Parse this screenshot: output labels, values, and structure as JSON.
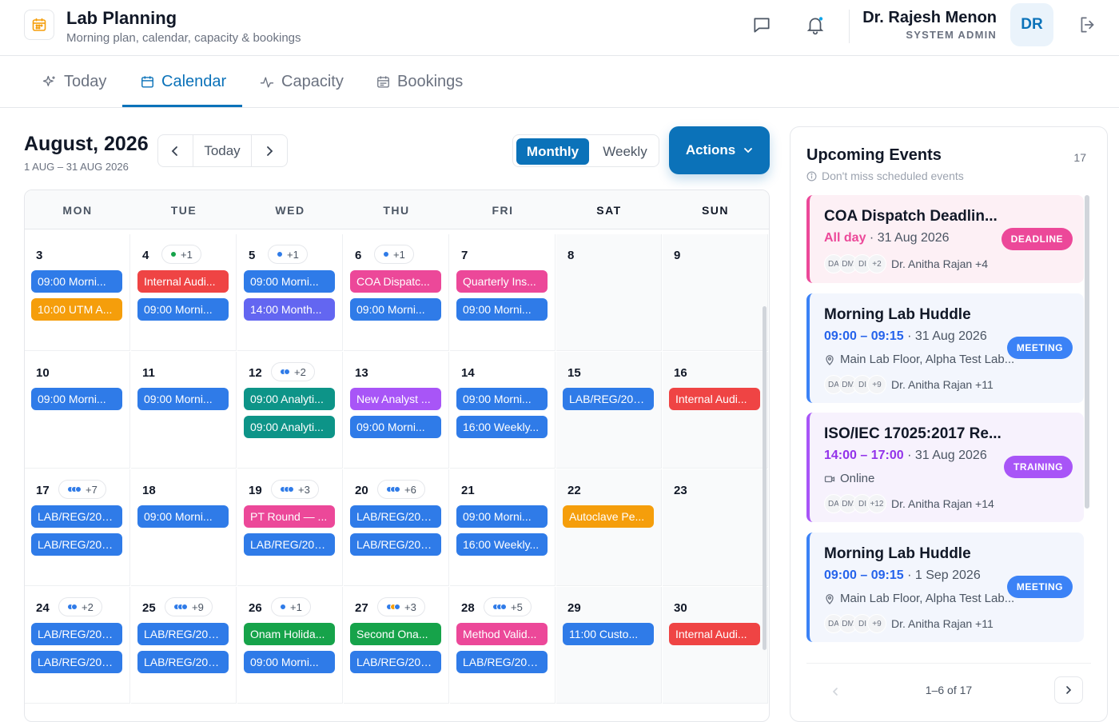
{
  "app": {
    "title": "Lab Planning",
    "subtitle": "Morning plan, calendar, capacity & bookings"
  },
  "user": {
    "name": "Dr. Rajesh Menon",
    "role": "SYSTEM ADMIN",
    "initials": "DR"
  },
  "tabs": [
    {
      "label": "Today",
      "icon": "sparkle-icon",
      "active": false
    },
    {
      "label": "Calendar",
      "icon": "calendar-icon",
      "active": true
    },
    {
      "label": "Capacity",
      "icon": "activity-icon",
      "active": false
    },
    {
      "label": "Bookings",
      "icon": "calendar-list-icon",
      "active": false
    }
  ],
  "calendar": {
    "title": "August, 2026",
    "range": "1 AUG – 31 AUG 2026",
    "today_label": "Today",
    "view_monthly": "Monthly",
    "view_weekly": "Weekly",
    "active_view": "Monthly",
    "actions_label": "Actions",
    "weekdays": [
      "MON",
      "TUE",
      "WED",
      "THU",
      "FRI",
      "SAT",
      "SUN"
    ]
  },
  "colors": {
    "blue": "#2f7be8",
    "orange": "#f59e0b",
    "red": "#ef4444",
    "indigo": "#6366f1",
    "pink": "#ec4899",
    "teal": "#0d9488",
    "purple": "#a855f7",
    "green": "#16a34a",
    "accent": "#0b72b9"
  },
  "weeks": [
    [
      {
        "day": "3",
        "more": "",
        "dots": [],
        "events": [
          {
            "text": "09:00 Morni...",
            "color": "blue"
          },
          {
            "text": "10:00 UTM A...",
            "color": "orange"
          }
        ]
      },
      {
        "day": "4",
        "more": "+1",
        "dots": [
          "#16a34a"
        ],
        "events": [
          {
            "text": "Internal Audi...",
            "color": "red"
          },
          {
            "text": "09:00 Morni...",
            "color": "blue"
          }
        ]
      },
      {
        "day": "5",
        "more": "+1",
        "dots": [
          "#2f7be8"
        ],
        "events": [
          {
            "text": "09:00 Morni...",
            "color": "blue"
          },
          {
            "text": "14:00 Month...",
            "color": "indigo"
          }
        ]
      },
      {
        "day": "6",
        "more": "+1",
        "dots": [
          "#2f7be8"
        ],
        "events": [
          {
            "text": "COA Dispatc...",
            "color": "pink"
          },
          {
            "text": "09:00 Morni...",
            "color": "blue"
          }
        ]
      },
      {
        "day": "7",
        "more": "",
        "dots": [],
        "events": [
          {
            "text": "Quarterly Ins...",
            "color": "pink"
          },
          {
            "text": "09:00 Morni...",
            "color": "blue"
          }
        ]
      },
      {
        "day": "8",
        "more": "",
        "dots": [],
        "events": []
      },
      {
        "day": "9",
        "more": "",
        "dots": [],
        "events": []
      }
    ],
    [
      {
        "day": "10",
        "more": "",
        "dots": [],
        "events": [
          {
            "text": "09:00 Morni...",
            "color": "blue"
          }
        ]
      },
      {
        "day": "11",
        "more": "",
        "dots": [],
        "events": [
          {
            "text": "09:00 Morni...",
            "color": "blue"
          }
        ]
      },
      {
        "day": "12",
        "more": "+2",
        "dots": [
          "#2f7be8",
          "#2f7be8"
        ],
        "events": [
          {
            "text": "09:00 Analyti...",
            "color": "teal"
          },
          {
            "text": "09:00 Analyti...",
            "color": "teal"
          }
        ]
      },
      {
        "day": "13",
        "more": "",
        "dots": [],
        "events": [
          {
            "text": "New Analyst ...",
            "color": "purple"
          },
          {
            "text": "09:00 Morni...",
            "color": "blue"
          }
        ]
      },
      {
        "day": "14",
        "more": "",
        "dots": [],
        "events": [
          {
            "text": "09:00 Morni...",
            "color": "blue"
          },
          {
            "text": "16:00 Weekly...",
            "color": "blue"
          }
        ]
      },
      {
        "day": "15",
        "more": "",
        "dots": [],
        "events": [
          {
            "text": "LAB/REG/202...",
            "color": "blue"
          }
        ]
      },
      {
        "day": "16",
        "more": "",
        "dots": [],
        "events": [
          {
            "text": "Internal Audi...",
            "color": "red"
          }
        ]
      }
    ],
    [
      {
        "day": "17",
        "more": "+7",
        "dots": [
          "#2f7be8",
          "#2f7be8",
          "#2f7be8"
        ],
        "events": [
          {
            "text": "LAB/REG/202...",
            "color": "blue"
          },
          {
            "text": "LAB/REG/202...",
            "color": "blue"
          }
        ]
      },
      {
        "day": "18",
        "more": "",
        "dots": [],
        "events": [
          {
            "text": "09:00 Morni...",
            "color": "blue"
          }
        ]
      },
      {
        "day": "19",
        "more": "+3",
        "dots": [
          "#2f7be8",
          "#2f7be8",
          "#2f7be8"
        ],
        "events": [
          {
            "text": "PT Round — ...",
            "color": "pink"
          },
          {
            "text": "LAB/REG/202...",
            "color": "blue"
          }
        ]
      },
      {
        "day": "20",
        "more": "+6",
        "dots": [
          "#2f7be8",
          "#2f7be8",
          "#2f7be8"
        ],
        "events": [
          {
            "text": "LAB/REG/202...",
            "color": "blue"
          },
          {
            "text": "LAB/REG/202...",
            "color": "blue"
          }
        ]
      },
      {
        "day": "21",
        "more": "",
        "dots": [],
        "events": [
          {
            "text": "09:00 Morni...",
            "color": "blue"
          },
          {
            "text": "16:00 Weekly...",
            "color": "blue"
          }
        ]
      },
      {
        "day": "22",
        "more": "",
        "dots": [],
        "events": [
          {
            "text": "Autoclave Pe...",
            "color": "orange"
          }
        ]
      },
      {
        "day": "23",
        "more": "",
        "dots": [],
        "events": []
      }
    ],
    [
      {
        "day": "24",
        "more": "+2",
        "dots": [
          "#2f7be8",
          "#2f7be8"
        ],
        "events": [
          {
            "text": "LAB/REG/202...",
            "color": "blue"
          },
          {
            "text": "LAB/REG/202...",
            "color": "blue"
          }
        ]
      },
      {
        "day": "25",
        "more": "+9",
        "dots": [
          "#2f7be8",
          "#2f7be8",
          "#2f7be8"
        ],
        "events": [
          {
            "text": "LAB/REG/202...",
            "color": "blue"
          },
          {
            "text": "LAB/REG/202...",
            "color": "blue"
          }
        ]
      },
      {
        "day": "26",
        "more": "+1",
        "dots": [
          "#2f7be8"
        ],
        "events": [
          {
            "text": "Onam Holida...",
            "color": "green"
          },
          {
            "text": "09:00 Morni...",
            "color": "blue"
          }
        ]
      },
      {
        "day": "27",
        "more": "+3",
        "dots": [
          "#2f7be8",
          "#f59e0b",
          "#2f7be8"
        ],
        "events": [
          {
            "text": "Second Ona...",
            "color": "green"
          },
          {
            "text": "LAB/REG/202...",
            "color": "blue"
          }
        ]
      },
      {
        "day": "28",
        "more": "+5",
        "dots": [
          "#2f7be8",
          "#2f7be8",
          "#2f7be8"
        ],
        "events": [
          {
            "text": "Method Valid...",
            "color": "pink"
          },
          {
            "text": "LAB/REG/202...",
            "color": "blue"
          }
        ]
      },
      {
        "day": "29",
        "more": "",
        "dots": [],
        "events": [
          {
            "text": "11:00 Custo...",
            "color": "blue"
          }
        ]
      },
      {
        "day": "30",
        "more": "",
        "dots": [],
        "events": [
          {
            "text": "Internal Audi...",
            "color": "red"
          }
        ]
      }
    ]
  ],
  "upcoming": {
    "title": "Upcoming Events",
    "count": "17",
    "subtitle": "Don't miss scheduled events",
    "cards": [
      {
        "title": "COA Dispatch Deadlin...",
        "time": "All day",
        "date": " · 31 Aug 2026",
        "location": "",
        "people": [
          "DA",
          "DM",
          "DI"
        ],
        "people_more": "+2",
        "people_text": "Dr. Anitha Rajan +4",
        "badge": "DEADLINE",
        "badge_color": "#ec4899",
        "bg": "#fdf0f5",
        "border": "#ec4899",
        "time_color": "#ec4899",
        "loc_icon": ""
      },
      {
        "title": "Morning Lab Huddle",
        "time": "09:00 – 09:15",
        "date": " · 31 Aug 2026",
        "location": "Main Lab Floor, Alpha Test Lab...",
        "people": [
          "DA",
          "DM",
          "DI"
        ],
        "people_more": "+9",
        "people_text": "Dr. Anitha Rajan +11",
        "badge": "MEETING",
        "badge_color": "#3b82f6",
        "bg": "#f3f6fd",
        "border": "#3b82f6",
        "time_color": "#2563eb",
        "loc_icon": "pin"
      },
      {
        "title": "ISO/IEC 17025:2017 Re...",
        "time": "14:00 – 17:00",
        "date": " · 31 Aug 2026",
        "location": "Online",
        "people": [
          "DA",
          "DM",
          "DI"
        ],
        "people_more": "+12",
        "people_text": "Dr. Anitha Rajan +14",
        "badge": "TRAINING",
        "badge_color": "#a855f7",
        "bg": "#f7f2fd",
        "border": "#a855f7",
        "time_color": "#9333ea",
        "loc_icon": "video"
      },
      {
        "title": "Morning Lab Huddle",
        "time": "09:00 – 09:15",
        "date": " · 1 Sep 2026",
        "location": "Main Lab Floor, Alpha Test Lab...",
        "people": [
          "DA",
          "DM",
          "DI"
        ],
        "people_more": "+9",
        "people_text": "Dr. Anitha Rajan +11",
        "badge": "MEETING",
        "badge_color": "#3b82f6",
        "bg": "#f3f6fd",
        "border": "#3b82f6",
        "time_color": "#2563eb",
        "loc_icon": "pin"
      }
    ],
    "pagination": "1–6 of 17"
  }
}
